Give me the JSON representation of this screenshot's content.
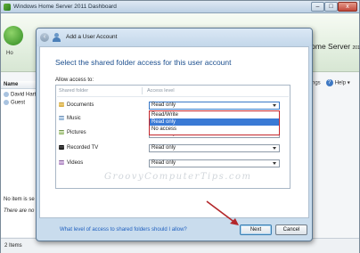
{
  "dashboard": {
    "title": "Windows Home Server 2011 Dashboard",
    "home_label": "Ho",
    "brand": "Home Server",
    "brand_suffix": "2011",
    "settings_label": "ngs",
    "help_label": "Help",
    "help_arrow": "▾",
    "list_header": "Name",
    "users": [
      "David Hart",
      "Guest"
    ],
    "note_selected": "No item is se",
    "note_tasks": "There are no",
    "status": "2 Items",
    "caption_buttons": {
      "minimize": "–",
      "maximize": "□",
      "close": "x"
    }
  },
  "dialog": {
    "title": "Add a User Account",
    "back_glyph": "‹",
    "heading": "Select the shared folder access for this user account",
    "allow_label": "Allow access to:",
    "columns": {
      "folder": "Shared folder",
      "level": "Access level"
    },
    "folders": [
      {
        "name": "Documents",
        "level": "Read only"
      },
      {
        "name": "Music",
        "level": ""
      },
      {
        "name": "Pictures",
        "level": "Read only"
      },
      {
        "name": "Recorded TV",
        "level": "Read only"
      },
      {
        "name": "Videos",
        "level": "Read only"
      }
    ],
    "dropdown_options": [
      "Read/Write",
      "Read only",
      "No access"
    ],
    "dropdown_selected": "Read only",
    "watermark": "GroovyComputerTips.com",
    "help_link": "What level of access to shared folders should I allow?",
    "next_button": "Next",
    "cancel_button": "Cancel"
  },
  "colors": {
    "heading": "#1c4f8e",
    "link": "#1f5fbf",
    "callout": "#c4262b",
    "selection": "#3a7ad5"
  }
}
